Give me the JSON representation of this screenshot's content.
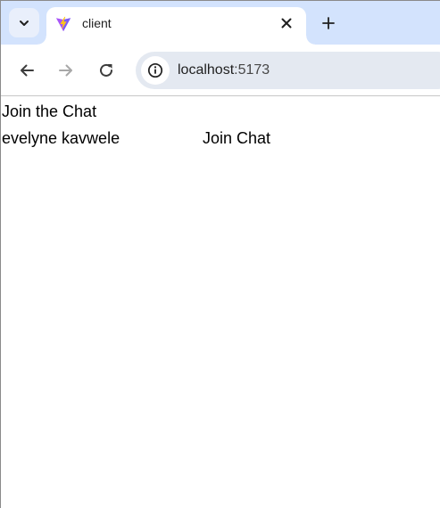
{
  "browser": {
    "tab": {
      "title": "client"
    },
    "address_bar": {
      "host": "localhost",
      "port": ":5173"
    },
    "icons": {
      "tab_search": "chevron-down-icon",
      "favicon": "vite-logo-icon",
      "close": "close-icon",
      "new_tab": "plus-icon",
      "back": "arrow-left-icon",
      "forward": "arrow-right-icon",
      "reload": "reload-icon",
      "site_info": "info-icon"
    },
    "colors": {
      "tabstrip_bg": "#d3e3fd",
      "omnibox_bg": "#e4e9f1",
      "favicon_purple": "#a855f7",
      "favicon_yellow": "#ffc517"
    }
  },
  "page": {
    "title": "Join the Chat",
    "name_value": "evelyne kavwele",
    "join_label": "Join Chat"
  }
}
